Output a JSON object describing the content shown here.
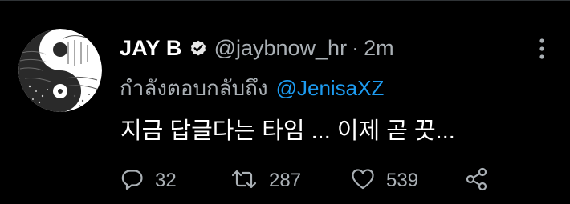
{
  "tweet": {
    "display_name": "JAY B",
    "handle": "@jaybnow_hr",
    "separator": "·",
    "time": "2m",
    "reply_prefix": "กำลังตอบกลับถึง",
    "reply_to": "@JenisaXZ",
    "text": "지금 답글다는 타임 ... 이제 곧 끗...",
    "stats": {
      "replies": "32",
      "retweets": "287",
      "likes": "539"
    }
  },
  "icons": {
    "verified": "verified-badge-icon",
    "more": "more-vertical-icon",
    "reply": "comment-icon",
    "retweet": "retweet-icon",
    "like": "heart-icon",
    "share": "share-icon"
  },
  "colors": {
    "background": "#000000",
    "text_primary": "#ffffff",
    "text_secondary": "#aab0b5",
    "accent": "#1d9bf0"
  }
}
